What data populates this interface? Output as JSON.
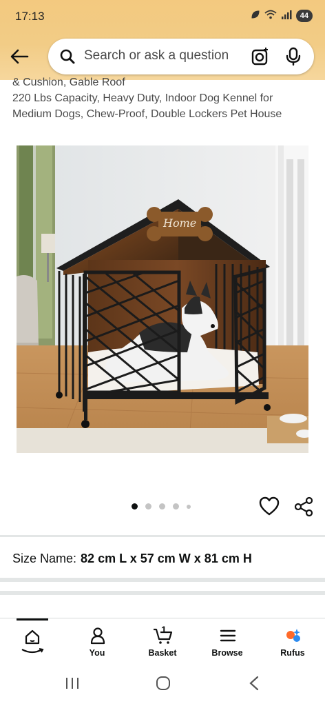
{
  "status_bar": {
    "time": "17:13",
    "battery": "44",
    "icons": [
      "leaf-icon",
      "wifi-icon",
      "signal-icon",
      "battery-icon"
    ]
  },
  "search": {
    "placeholder": "Search or ask a question",
    "icons": [
      "back-arrow-icon",
      "search-icon",
      "camera-lens-icon",
      "microphone-icon"
    ]
  },
  "product": {
    "title_clipped": "& Cushion, Gable Roof",
    "title_lines": [
      "220 Lbs Capacity, Heavy Duty, Indoor Dog Kennel for",
      "Medium Dogs, Chew-Proof, Double Lockers Pet House"
    ],
    "image_sign_text": "Home",
    "carousel": {
      "count": 5,
      "active_index": 0
    }
  },
  "variant": {
    "label": "Size Name:",
    "value": "82 cm L x 57 cm W x 81 cm H"
  },
  "bottom_nav": {
    "items": [
      {
        "label": "",
        "icon": "home-icon"
      },
      {
        "label": "You",
        "icon": "person-icon"
      },
      {
        "label": "Basket",
        "icon": "basket-icon",
        "badge": "1"
      },
      {
        "label": "Browse",
        "icon": "menu-icon"
      },
      {
        "label": "Rufus",
        "icon": "rufus-icon"
      }
    ]
  },
  "colors": {
    "header_bg": "#f3c97f",
    "rufus_orange": "#ff6a2a",
    "rufus_blue": "#2d8cf0"
  }
}
